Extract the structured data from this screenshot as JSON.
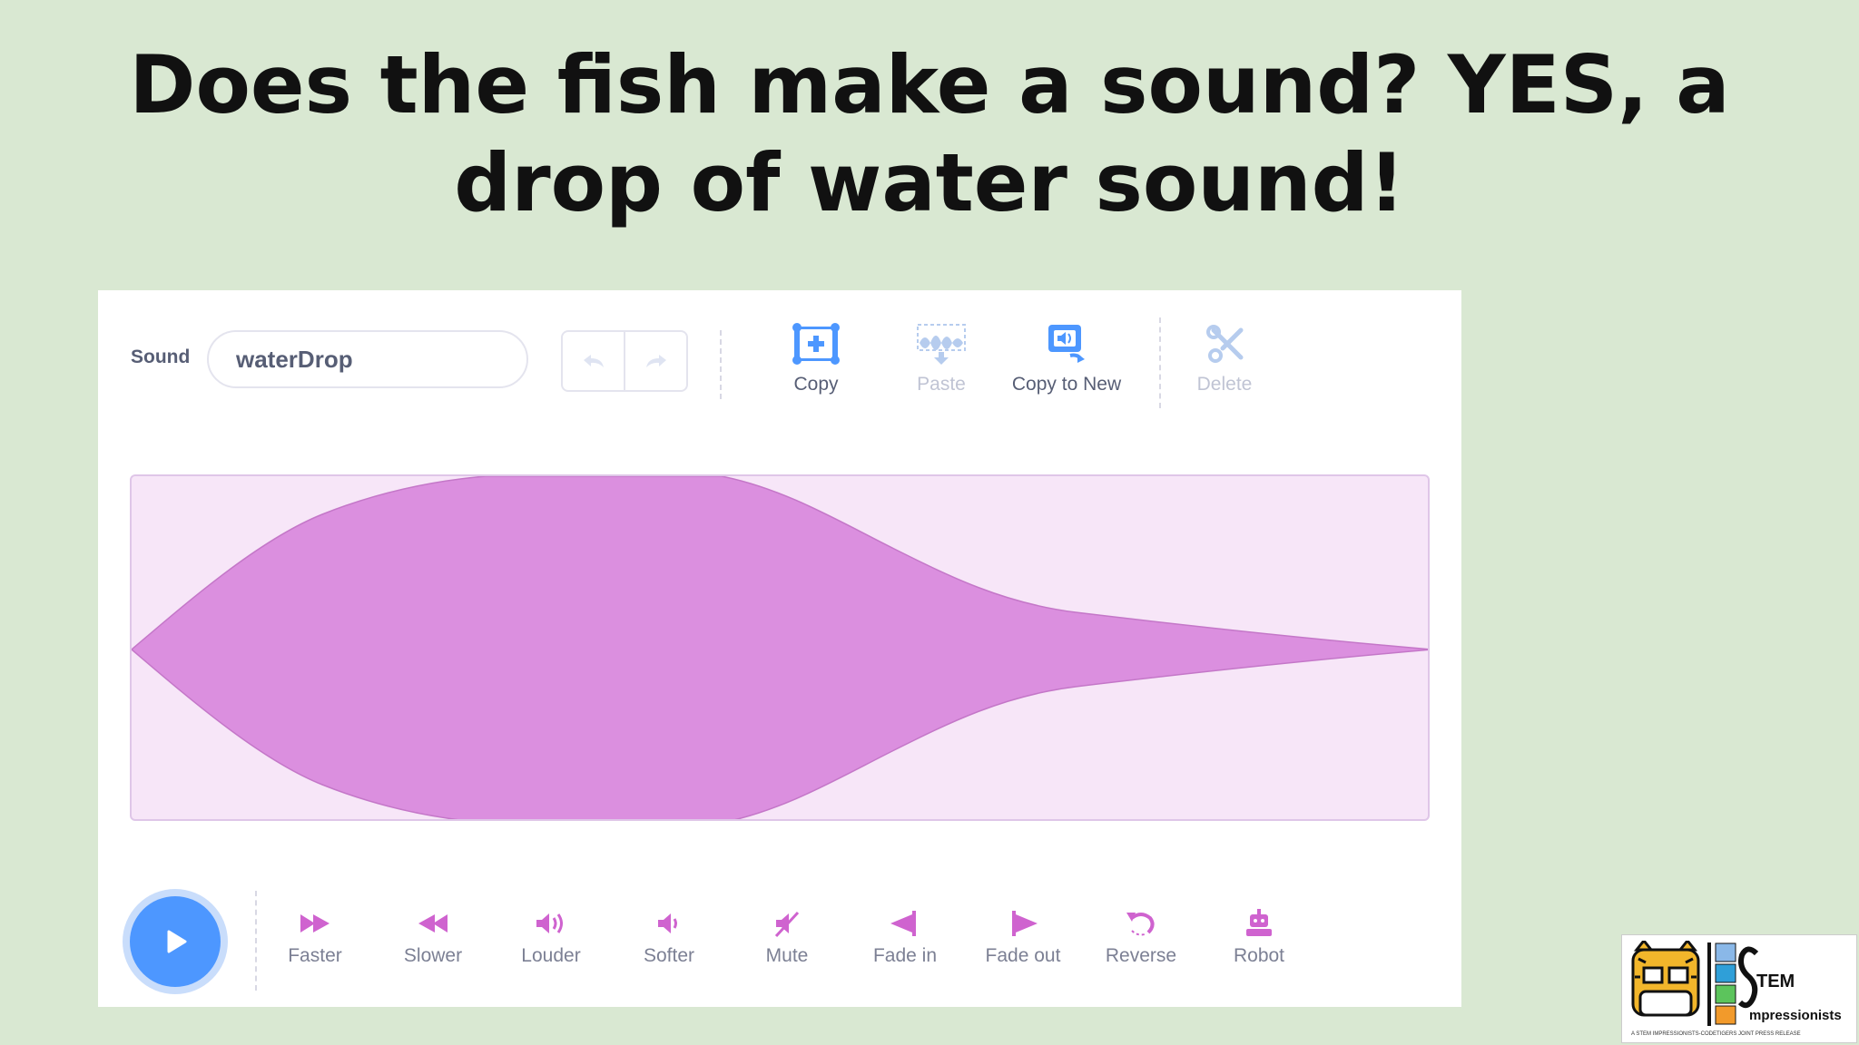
{
  "slide": {
    "title": "Does the fish make a sound?  YES, a drop of water sound!"
  },
  "editor": {
    "sound_label": "Sound",
    "sound_name": "waterDrop",
    "tools": [
      {
        "label": "Copy",
        "icon": "copy-icon",
        "enabled": true
      },
      {
        "label": "Paste",
        "icon": "paste-icon",
        "enabled": false
      },
      {
        "label": "Copy to New",
        "icon": "copy-to-new-icon",
        "enabled": true
      },
      {
        "label": "Delete",
        "icon": "delete-icon",
        "enabled": false
      }
    ],
    "effects": [
      {
        "label": "Faster",
        "icon": "faster-icon"
      },
      {
        "label": "Slower",
        "icon": "slower-icon"
      },
      {
        "label": "Louder",
        "icon": "louder-icon"
      },
      {
        "label": "Softer",
        "icon": "softer-icon"
      },
      {
        "label": "Mute",
        "icon": "mute-icon"
      },
      {
        "label": "Fade in",
        "icon": "fade-in-icon"
      },
      {
        "label": "Fade out",
        "icon": "fade-out-icon"
      },
      {
        "label": "Reverse",
        "icon": "reverse-icon"
      },
      {
        "label": "Robot",
        "icon": "robot-icon"
      }
    ]
  },
  "colors": {
    "background": "#d9e8d2",
    "waveform_fill": "#db8fdf",
    "waveform_bg": "#f7e6f8",
    "accent_blue": "#4d97ff",
    "effect_pink": "#cf63cf"
  },
  "logo": {
    "line1": "TEM",
    "line2": "mpressionists",
    "tagline": "A STEM IMPRESSIONISTS-CODETIGERS JOINT PRESS RELEASE"
  }
}
